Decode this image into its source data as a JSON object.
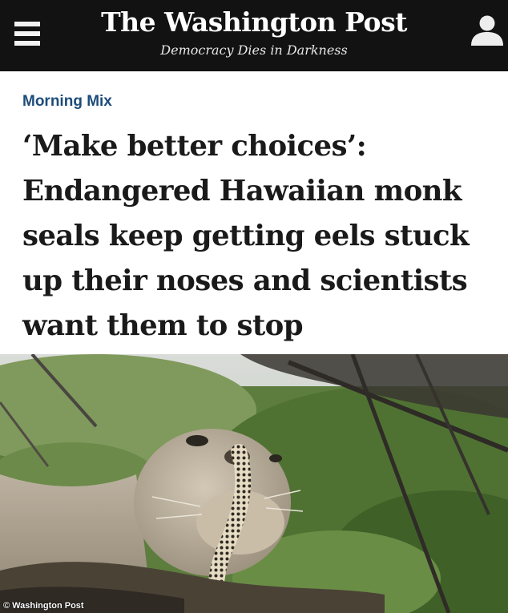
{
  "header": {
    "masthead": "The Washington Post",
    "tagline": "Democracy Dies in Darkness",
    "background_color": "#121212",
    "menu_icon": "hamburger-menu-icon",
    "account_icon": "user-account-icon"
  },
  "article": {
    "section": "Morning Mix",
    "section_color": "#1d4c7a",
    "headline_lines": [
      "‘Make better choices’:",
      "Endangered Hawaiian monk",
      "seals keep getting eels stuck",
      "up their noses and scientists",
      "want them to stop"
    ]
  },
  "photo": {
    "credit": "© Washington Post"
  }
}
